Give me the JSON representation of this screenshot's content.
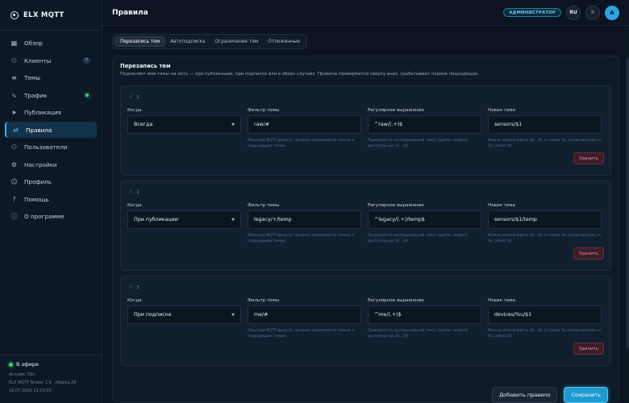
{
  "brand": {
    "name": "ELX MQTT"
  },
  "sidebar": {
    "items": [
      {
        "label": "Обзор",
        "icon": "grid-icon",
        "glyph": "▦"
      },
      {
        "label": "Клиенты",
        "icon": "users-icon",
        "glyph": "⚇",
        "badge": "7"
      },
      {
        "label": "Темы",
        "icon": "list-icon",
        "glyph": "≡"
      },
      {
        "label": "Трафик",
        "icon": "pulse-icon",
        "glyph": "∿"
      },
      {
        "label": "Публикация",
        "icon": "send-icon",
        "glyph": "➤"
      },
      {
        "label": "Правила",
        "icon": "shuffle-icon",
        "glyph": "⇄"
      },
      {
        "label": "Пользователи",
        "icon": "user-group-icon",
        "glyph": "⚇"
      },
      {
        "label": "Настройки",
        "icon": "gear-icon",
        "glyph": "⚙"
      },
      {
        "label": "Профиль",
        "icon": "user-icon",
        "glyph": "☺"
      },
      {
        "label": "Помощь",
        "icon": "help-icon",
        "glyph": "?"
      },
      {
        "label": "О программе",
        "icon": "info-icon",
        "glyph": "ⓘ"
      }
    ],
    "status": {
      "live": "В эфире",
      "uptime": "Аптайм: 53с",
      "build": "ELX MQTT Broker 1.0 · сборка 28",
      "datetime": "19.07.2026 13:23:03"
    }
  },
  "header": {
    "title": "Правила",
    "role": "АДМИНИСТРАТОР",
    "lang": "RU",
    "avatar": "A"
  },
  "tabs": [
    {
      "label": "Перезапись тем"
    },
    {
      "label": "Автоподписка"
    },
    {
      "label": "Ограничение тем"
    },
    {
      "label": "Отложенные"
    }
  ],
  "panel": {
    "title": "Перезапись тем",
    "description": "Подменяет имя темы на лету — при публикации, при подписке или в обоих случаях. Правила проверяются сверху вниз, срабатывает первое подходящее."
  },
  "labels": {
    "when": "Когда",
    "filter": "Фильтр темы",
    "regex": "Регулярное выражение",
    "new_topic": "Новая тема",
    "delete": "Удалить"
  },
  "hints": {
    "filter": "Обычный MQTT-фильтр: правило применяется только к подходящим темам",
    "regex": "Проверяется на подошедшей теме; группы захвата доступны как $1...$9",
    "new_topic": "Можно использовать $1...$9, а также %u (пользователь) и %c (client id)"
  },
  "rules": [
    {
      "index": "1",
      "when": "Всегда",
      "filter": "raw/#",
      "regex": "^raw/(.+)$",
      "new_topic": "sensors/$1"
    },
    {
      "index": "2",
      "when": "При публикации",
      "filter": "legacy/+/temp",
      "regex": "^legacy/(.+)/temp$",
      "new_topic": "sensors/$1/temp"
    },
    {
      "index": "3",
      "when": "При подписке",
      "filter": "me/#",
      "regex": "^me/(.+)$",
      "new_topic": "devices/%u/$1"
    }
  ],
  "actions": {
    "add": "Добавить правило",
    "save": "Сохранить"
  },
  "colors": {
    "accent": "#38b6e8",
    "live": "#3ad16b",
    "danger": "#ef8a9b"
  }
}
